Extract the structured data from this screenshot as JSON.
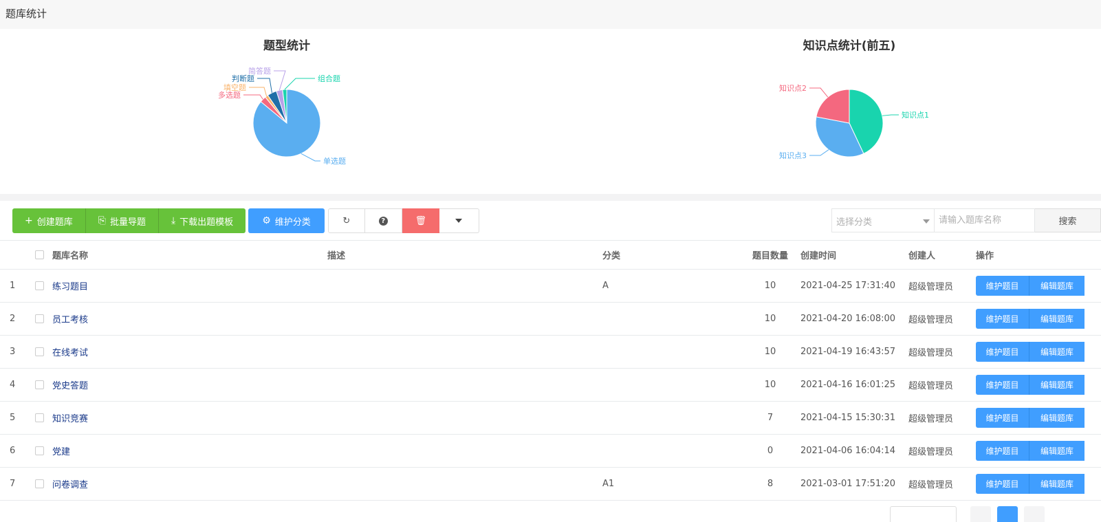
{
  "page_title": "题库统计",
  "charts": {
    "type_chart": {
      "title": "题型统计",
      "slices": [
        {
          "label": "单选题",
          "color": "#5aaef0",
          "pct": 86
        },
        {
          "label": "多选题",
          "color": "#f4687f",
          "pct": 3
        },
        {
          "label": "填空题",
          "color": "#f9b36b",
          "pct": 1.5
        },
        {
          "label": "判断题",
          "color": "#1f6fa8",
          "pct": 4.5
        },
        {
          "label": "简答题",
          "color": "#b8a2e8",
          "pct": 3
        },
        {
          "label": "组合题",
          "color": "#19d4ae",
          "pct": 2
        }
      ]
    },
    "knowledge_chart": {
      "title": "知识点统计(前五)",
      "slices": [
        {
          "label": "知识点1",
          "color": "#19d4ae",
          "pct": 43
        },
        {
          "label": "知识点3",
          "color": "#5aaef0",
          "pct": 35
        },
        {
          "label": "知识点2",
          "color": "#f4687f",
          "pct": 22
        }
      ]
    }
  },
  "chart_data": [
    {
      "type": "pie",
      "title": "题型统计",
      "categories": [
        "单选题",
        "多选题",
        "填空题",
        "判断题",
        "简答题",
        "组合题"
      ],
      "values": [
        86,
        3,
        1.5,
        4.5,
        3,
        2
      ]
    },
    {
      "type": "pie",
      "title": "知识点统计(前五)",
      "categories": [
        "知识点1",
        "知识点3",
        "知识点2"
      ],
      "values": [
        43,
        35,
        22
      ]
    }
  ],
  "toolbar": {
    "create": "创建题库",
    "import": "批量导题",
    "download": "下载出题模板",
    "categories": "维护分类"
  },
  "search": {
    "select_placeholder": "选择分类",
    "name_placeholder": "请输入题库名称",
    "button": "搜索"
  },
  "table": {
    "headers": {
      "name": "题库名称",
      "desc": "描述",
      "category": "分类",
      "count": "题目数量",
      "created": "创建时间",
      "creator": "创建人",
      "ops": "操作"
    },
    "op_labels": {
      "maintain": "维护题目",
      "edit": "编辑题库"
    },
    "rows": [
      {
        "idx": "1",
        "name": "练习题目",
        "desc": "",
        "category": "A",
        "count": "10",
        "created": "2021-04-25 17:31:40",
        "creator": "超级管理员"
      },
      {
        "idx": "2",
        "name": "员工考核",
        "desc": "",
        "category": "",
        "count": "10",
        "created": "2021-04-20 16:08:00",
        "creator": "超级管理员"
      },
      {
        "idx": "3",
        "name": "在线考试",
        "desc": "",
        "category": "",
        "count": "10",
        "created": "2021-04-19 16:43:57",
        "creator": "超级管理员"
      },
      {
        "idx": "4",
        "name": "党史答题",
        "desc": "",
        "category": "",
        "count": "10",
        "created": "2021-04-16 16:01:25",
        "creator": "超级管理员"
      },
      {
        "idx": "5",
        "name": "知识竞赛",
        "desc": "",
        "category": "",
        "count": "7",
        "created": "2021-04-15 15:30:31",
        "creator": "超级管理员"
      },
      {
        "idx": "6",
        "name": "党建",
        "desc": "",
        "category": "",
        "count": "0",
        "created": "2021-04-06 16:04:14",
        "creator": "超级管理员"
      },
      {
        "idx": "7",
        "name": "问卷调查",
        "desc": "",
        "category": "A1",
        "count": "8",
        "created": "2021-03-01 17:51:20",
        "creator": "超级管理员"
      }
    ]
  }
}
